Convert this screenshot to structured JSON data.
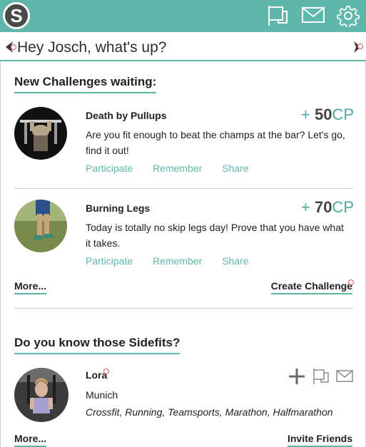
{
  "header": {
    "logo_letter": "S",
    "icons": [
      "flag-icon",
      "mail-icon",
      "gear-icon"
    ],
    "accent": "#5fb6ab"
  },
  "greeting": "Hey Josch, what's up?",
  "challenges_section": {
    "title": "New Challenges waiting:",
    "items": [
      {
        "title": "Death by Pullups",
        "points_prefix": "+ ",
        "points": "50",
        "points_unit": "CP",
        "description": "Are you fit enough to beat the champs at the bar? Let's go, find it out!",
        "actions": [
          "Participate",
          "Remember",
          "Share"
        ]
      },
      {
        "title": "Burning Legs",
        "points_prefix": "+ ",
        "points": "70",
        "points_unit": "CP",
        "description": "Today is totally no skip legs day! Prove that you have what it takes.",
        "actions": [
          "Participate",
          "Remember",
          "Share"
        ]
      }
    ],
    "more_label": "More...",
    "create_label": "Create Challenge"
  },
  "sidefits_section": {
    "title": "Do you know those Sidefits?",
    "person": {
      "name": "Lora",
      "city": "Munich",
      "sports": "Crossfit, Running, Teamsports, Marathon, Halfmarathon"
    },
    "more_label": "More...",
    "invite_label": "Invite Friends"
  }
}
